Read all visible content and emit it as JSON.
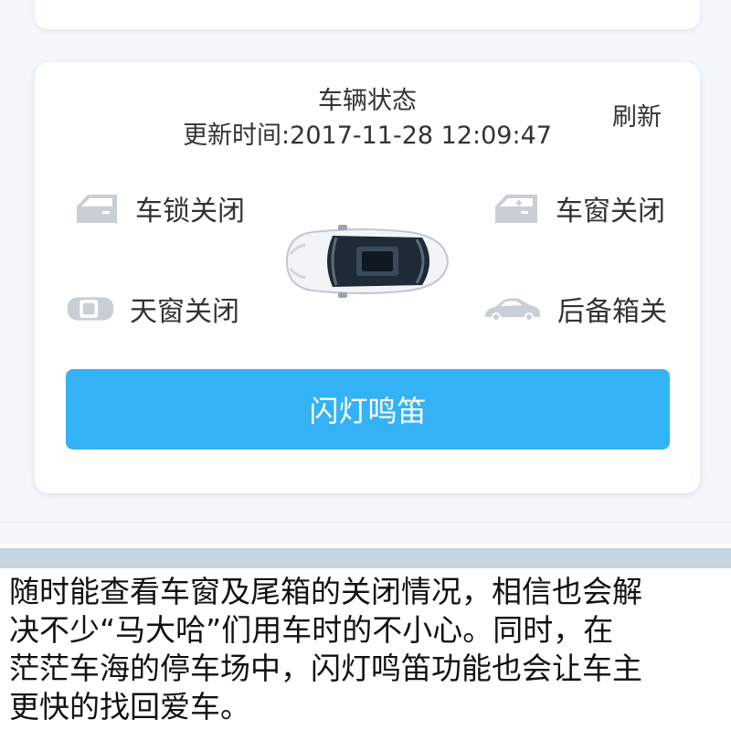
{
  "vehicle_status": {
    "title": "车辆状态",
    "update_time_label": "更新时间:",
    "update_time_value": "2017-11-28 12:09:47",
    "refresh_label": "刷新",
    "items": [
      {
        "label": "车锁关闭",
        "icon": "car-door-icon"
      },
      {
        "label": "天窗关闭",
        "icon": "sunroof-icon"
      },
      {
        "label": "车窗关闭",
        "icon": "car-window-icon"
      },
      {
        "label": "后备箱关",
        "icon": "car-trunk-icon"
      }
    ],
    "car_image": "car-top-view",
    "flash_horn_label": "闪灯鸣笛"
  },
  "caption": {
    "lines": [
      "随时能查看车窗及尾箱的关闭情况，相信也会解",
      "决不少“马大哈”们用车时的不小心。同时，在",
      "茫茫车海的停车场中，闪灯鸣笛功能也会让车主",
      "更快的找回爱车。"
    ]
  },
  "colors": {
    "primary": "#34b2f6",
    "page_bg": "#f5f8fb",
    "card_bg": "#ffffff",
    "icon_gray": "#c8cfd6",
    "band": "#c5d4df"
  }
}
